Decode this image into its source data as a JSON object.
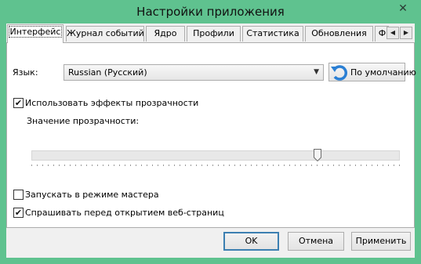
{
  "window": {
    "title": "Настройки приложения",
    "close_glyph": "✕"
  },
  "tabs": [
    {
      "label": "Интерфейс",
      "active": true
    },
    {
      "label": "Журнал событий"
    },
    {
      "label": "Ядро"
    },
    {
      "label": "Профили"
    },
    {
      "label": "Статистика"
    },
    {
      "label": "Обновления"
    },
    {
      "label": "Ф"
    }
  ],
  "tab_scroll": {
    "left_glyph": "◀",
    "right_glyph": "▶"
  },
  "language": {
    "label": "Язык:",
    "value": "Russian (Русский)",
    "default_button": "По умолчанию",
    "default_button_icon": "refresh-icon"
  },
  "transparency": {
    "checkbox_label": "Использовать эффекты прозрачности",
    "checked": true,
    "value_label": "Значение прозрачности:",
    "slider_fraction": 0.78
  },
  "wizard_mode": {
    "label": "Запускать в режиме мастера",
    "checked": false
  },
  "ask_before_open": {
    "label": "Спрашивать перед открытием веб-страниц",
    "checked": true
  },
  "checkmark": "✔",
  "buttons": {
    "ok": "OK",
    "cancel": "Отмена",
    "apply": "Применить"
  },
  "colors": {
    "title_bar": "#5fc28f",
    "default_button_border": "#3c7fb1"
  }
}
